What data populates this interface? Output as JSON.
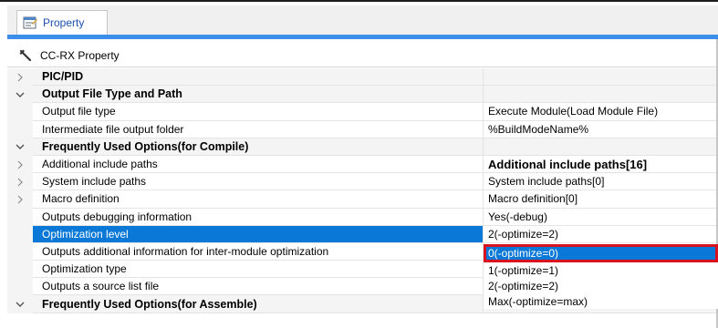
{
  "tab": {
    "label": "Property"
  },
  "panel": {
    "title": "CC-RX Property"
  },
  "rows": [
    {
      "type": "category",
      "state": "collapsed",
      "label": "PIC/PID",
      "value": ""
    },
    {
      "type": "category",
      "state": "expanded",
      "label": "Output File Type and Path",
      "value": ""
    },
    {
      "type": "property",
      "state": "",
      "label": "Output file type",
      "value": "Execute Module(Load Module File)"
    },
    {
      "type": "property",
      "state": "",
      "label": "Intermediate file output folder",
      "value": "%BuildModeName%"
    },
    {
      "type": "category",
      "state": "expanded",
      "label": "Frequently Used Options(for Compile)",
      "value": ""
    },
    {
      "type": "property",
      "state": "collapsed",
      "label": "Additional include paths",
      "value": "Additional include paths[16]",
      "bold": true
    },
    {
      "type": "property",
      "state": "collapsed",
      "label": "System include paths",
      "value": "System include paths[0]"
    },
    {
      "type": "property",
      "state": "collapsed",
      "label": "Macro definition",
      "value": "Macro definition[0]"
    },
    {
      "type": "property",
      "state": "",
      "label": "Outputs debugging information",
      "value": "Yes(-debug)"
    },
    {
      "type": "property",
      "state": "",
      "label": "Optimization level",
      "value": "2(-optimize=2)",
      "selected": true
    },
    {
      "type": "property",
      "state": "",
      "label": "Outputs additional information for inter-module optimization",
      "value": ""
    },
    {
      "type": "property",
      "state": "",
      "label": "Optimization type",
      "value": ""
    },
    {
      "type": "property",
      "state": "",
      "label": "Outputs a source list file",
      "value": ""
    },
    {
      "type": "category",
      "state": "expanded",
      "label": "Frequently Used Options(for Assemble)",
      "value": ""
    }
  ],
  "dropdown": {
    "options": [
      "0(-optimize=0)",
      "1(-optimize=1)",
      "2(-optimize=2)",
      "Max(-optimize=max)"
    ],
    "highlighted": "0(-optimize=0)"
  },
  "colors": {
    "selection": "#0a78d7",
    "highlight_border": "#d9121f",
    "accent": "#3d8ee8"
  }
}
